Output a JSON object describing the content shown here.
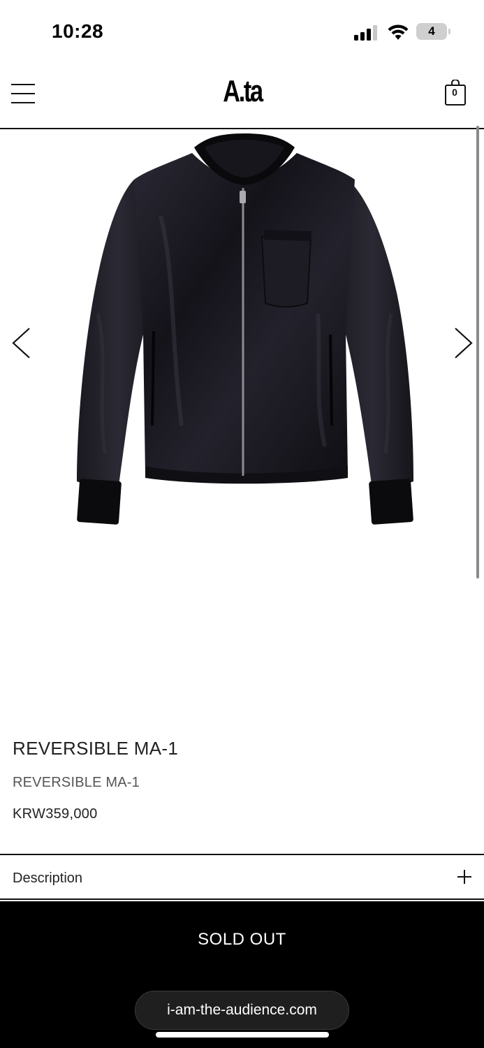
{
  "status_bar": {
    "time": "10:28",
    "battery_level": "4",
    "icons": [
      "cellular-signal-icon",
      "wifi-icon",
      "battery-icon"
    ]
  },
  "header": {
    "logo": "A.ta",
    "cart_count": "0",
    "icons": [
      "hamburger-menu-icon",
      "shopping-bag-icon"
    ]
  },
  "gallery": {
    "image_description": "black-bomber-jacket",
    "icons": [
      "chevron-left-icon",
      "chevron-right-icon"
    ]
  },
  "product": {
    "title": "REVERSIBLE MA-1",
    "subtitle": "REVERSIBLE MA-1",
    "price": "KRW359,000"
  },
  "description": {
    "label": "Description",
    "icon": "plus-icon"
  },
  "purchase": {
    "button_label": "SOLD OUT"
  },
  "browser": {
    "url": "i-am-the-audience.com"
  },
  "colors": {
    "background": "#ffffff",
    "text": "#111111",
    "bar": "#000000"
  }
}
